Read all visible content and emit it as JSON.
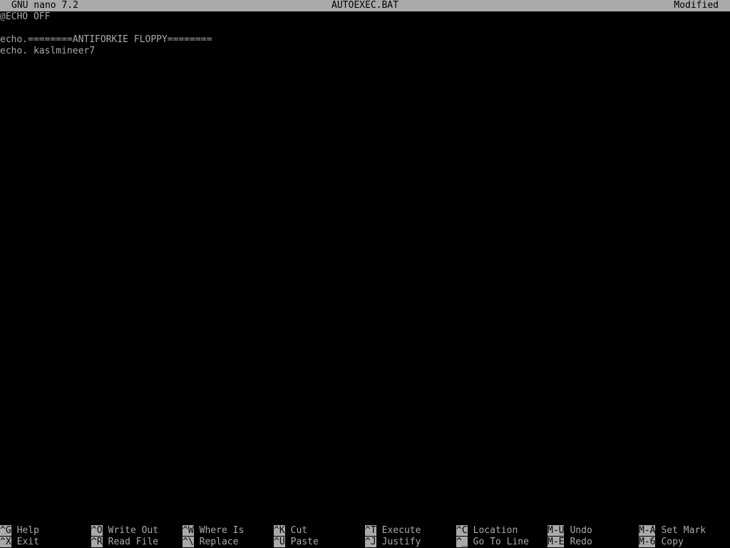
{
  "titlebar": {
    "version": "GNU nano 7.2",
    "filename": "AUTOEXEC.BAT",
    "status": "Modified"
  },
  "buffer": {
    "lines": [
      "@ECHO OFF",
      "",
      "echo.========ANTIFORKIE FLOPPY========",
      "echo. kaslmineer7"
    ]
  },
  "shortcuts": {
    "row1": [
      {
        "key": "^G",
        "label": "Help"
      },
      {
        "key": "^O",
        "label": "Write Out"
      },
      {
        "key": "^W",
        "label": "Where Is"
      },
      {
        "key": "^K",
        "label": "Cut"
      },
      {
        "key": "^T",
        "label": "Execute"
      },
      {
        "key": "^C",
        "label": "Location"
      },
      {
        "key": "M-U",
        "label": "Undo"
      },
      {
        "key": "M-A",
        "label": "Set Mark"
      }
    ],
    "row2": [
      {
        "key": "^X",
        "label": "Exit"
      },
      {
        "key": "^R",
        "label": "Read File"
      },
      {
        "key": "^\\",
        "label": "Replace"
      },
      {
        "key": "^U",
        "label": "Paste"
      },
      {
        "key": "^J",
        "label": "Justify"
      },
      {
        "key": "^_",
        "label": "Go To Line"
      },
      {
        "key": "M-E",
        "label": "Redo"
      },
      {
        "key": "M-6",
        "label": "Copy"
      }
    ]
  },
  "colors": {
    "background": "#000000",
    "foreground": "#aaaaaa",
    "inverse_bg": "#aaaaaa",
    "inverse_fg": "#000000"
  }
}
